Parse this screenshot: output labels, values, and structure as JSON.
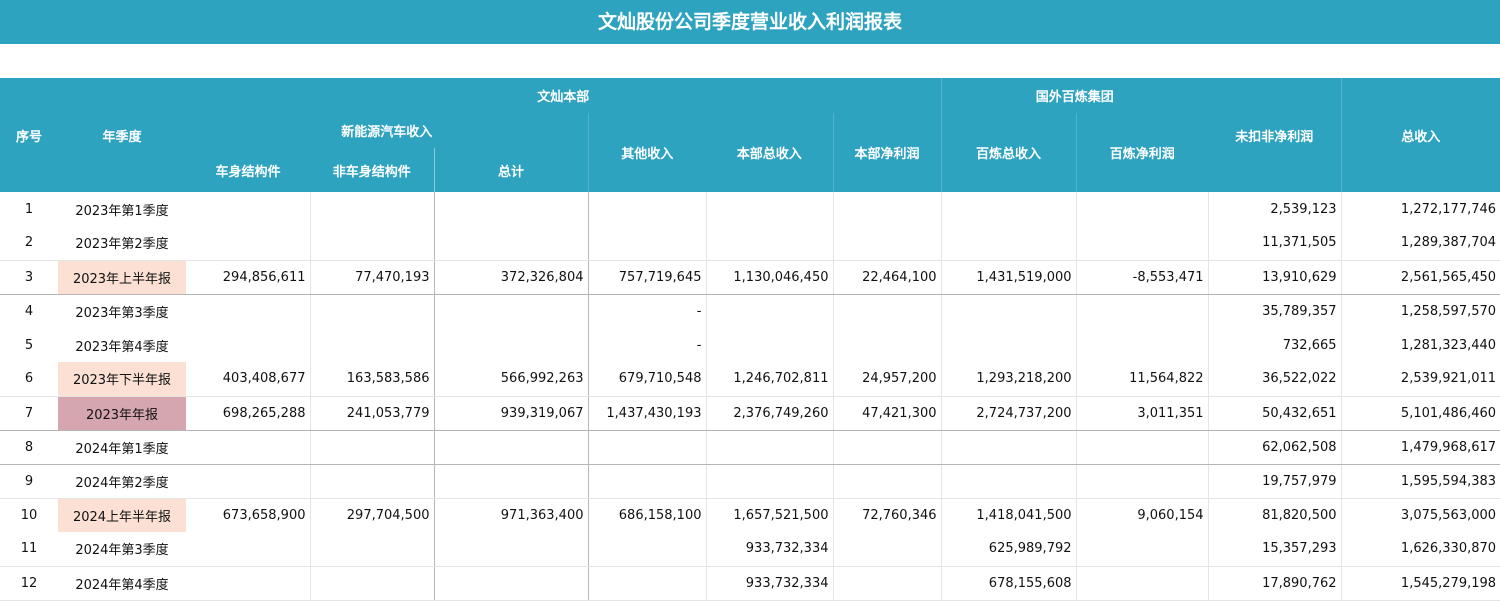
{
  "title": "文灿股份公司季度营业收入利润报表",
  "headers": {
    "seq": "序号",
    "period": "年季度",
    "hq": "文灿本部",
    "overseas": "国外百炼集团",
    "nev": "新能源汽车收入",
    "body_parts": "车身结构件",
    "non_body_parts": "非车身结构件",
    "subtotal": "总计",
    "other_income": "其他收入",
    "hq_total_income": "本部总收入",
    "hq_net_profit": "本部净利润",
    "bl_total_income": "百炼总收入",
    "bl_net_profit": "百炼净利润",
    "net_profit": "未扣非净利润",
    "total_income": "总收入"
  },
  "rows": [
    [
      "1",
      "2023年第1季度",
      "",
      "",
      "",
      "",
      "",
      "",
      "",
      "",
      "2,539,123",
      "1,272,177,746"
    ],
    [
      "2",
      "2023年第2季度",
      "",
      "",
      "",
      "",
      "",
      "",
      "",
      "",
      "11,371,505",
      "1,289,387,704"
    ],
    [
      "3",
      "2023年上半年报",
      "294,856,611",
      "77,470,193",
      "372,326,804",
      "757,719,645",
      "1,130,046,450",
      "22,464,100",
      "1,431,519,000",
      "-8,553,471",
      "13,910,629",
      "2,561,565,450"
    ],
    [
      "4",
      "2023年第3季度",
      "",
      "",
      "",
      "-",
      "",
      "",
      "",
      "",
      "35,789,357",
      "1,258,597,570"
    ],
    [
      "5",
      "2023年第4季度",
      "",
      "",
      "",
      "-",
      "",
      "",
      "",
      "",
      "732,665",
      "1,281,323,440"
    ],
    [
      "6",
      "2023年下半年报",
      "403,408,677",
      "163,583,586",
      "566,992,263",
      "679,710,548",
      "1,246,702,811",
      "24,957,200",
      "1,293,218,200",
      "11,564,822",
      "36,522,022",
      "2,539,921,011"
    ],
    [
      "7",
      "2023年年报",
      "698,265,288",
      "241,053,779",
      "939,319,067",
      "1,437,430,193",
      "2,376,749,260",
      "47,421,300",
      "2,724,737,200",
      "3,011,351",
      "50,432,651",
      "5,101,486,460"
    ],
    [
      "8",
      "2024年第1季度",
      "",
      "",
      "",
      "",
      "",
      "",
      "",
      "",
      "62,062,508",
      "1,479,968,617"
    ],
    [
      "9",
      "2024年第2季度",
      "",
      "",
      "",
      "",
      "",
      "",
      "",
      "",
      "19,757,979",
      "1,595,594,383"
    ],
    [
      "10",
      "2024上年半年报",
      "673,658,900",
      "297,704,500",
      "971,363,400",
      "686,158,100",
      "1,657,521,500",
      "72,760,346",
      "1,418,041,500",
      "9,060,154",
      "81,820,500",
      "3,075,563,000"
    ],
    [
      "11",
      "2024年第3季度",
      "",
      "",
      "",
      "",
      "933,732,334",
      "",
      "625,989,792",
      "",
      "15,357,293",
      "1,626,330,870"
    ],
    [
      "12",
      "2024年第4季度",
      "",
      "",
      "",
      "",
      "933,732,334",
      "",
      "678,155,608",
      "",
      "17,890,762",
      "1,545,279,198"
    ]
  ],
  "colors": {
    "header_bg": "#2ea3c0",
    "half_year_bg": "#fbe0d3",
    "annual_bg": "#d5a6b0"
  }
}
